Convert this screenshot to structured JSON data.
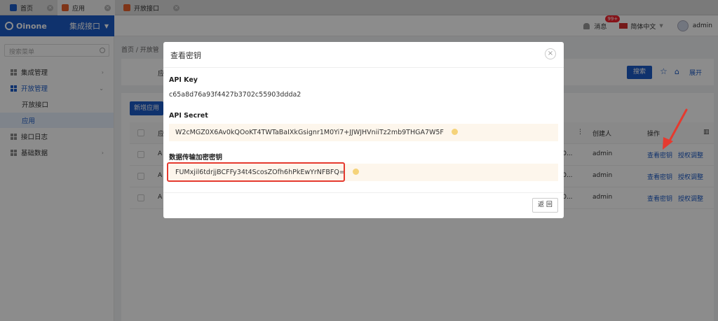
{
  "browser_tabs": [
    {
      "label": "首页",
      "icon": "home-icon",
      "color": "#1d5bc6"
    },
    {
      "label": "应用",
      "icon": "app-icon",
      "color": "#e8622c"
    },
    {
      "label": "开放接口",
      "icon": "app-icon",
      "color": "#e8622c"
    }
  ],
  "header": {
    "logo_text": "Oinone",
    "module": "集成接口",
    "messages_label": "消息",
    "messages_badge": "99+",
    "language": "简体中文",
    "user": "admin"
  },
  "sidebar": {
    "search_placeholder": "搜索菜单",
    "items": [
      {
        "label": "集成管理"
      },
      {
        "label": "开放管理"
      },
      {
        "label": "开放接口"
      },
      {
        "label": "应用"
      },
      {
        "label": "接口日志"
      },
      {
        "label": "基础数据"
      }
    ]
  },
  "breadcrumb": "首页 / 开放管",
  "main": {
    "search_button": "搜索",
    "expand_label": "展开",
    "new_button": "新增应用",
    "filter_label_fragment": "应",
    "table": {
      "headers": [
        "应",
        "创建人",
        "操作"
      ],
      "rows": [
        {
          "name": "A",
          "time": "--30...",
          "creator": "admin",
          "action1": "查看密钥",
          "action2": "授权调整"
        },
        {
          "name": "A",
          "time": "--30...",
          "creator": "admin",
          "action1": "查看密钥",
          "action2": "授权调整"
        },
        {
          "name": "A",
          "time": "--30...",
          "creator": "admin",
          "action1": "查看密钥",
          "action2": "授权调整"
        }
      ]
    }
  },
  "modal": {
    "title": "查看密钥",
    "api_key_label": "API Key",
    "api_key_value": "c65a8d76a93f4427b3702c55903ddda2",
    "api_secret_label": "API Secret",
    "api_secret_value": "W2cMGZ0X6Av0kQOoKT4TWTaBaIXkGsignr1M0Yi7+JJWJHVniiTz2mb9THGA7W5F",
    "encrypt_key_label": "数据传输加密密钥",
    "encrypt_key_value": "FUMxjil6tdrjjBCFFy34t4ScosZOfh6hPkEwYrNFBFQ=",
    "back_button": "返 回"
  },
  "colors": {
    "primary": "#1d5bc6",
    "highlight": "#e53a2f",
    "copy_bg": "#fdf6ec"
  }
}
